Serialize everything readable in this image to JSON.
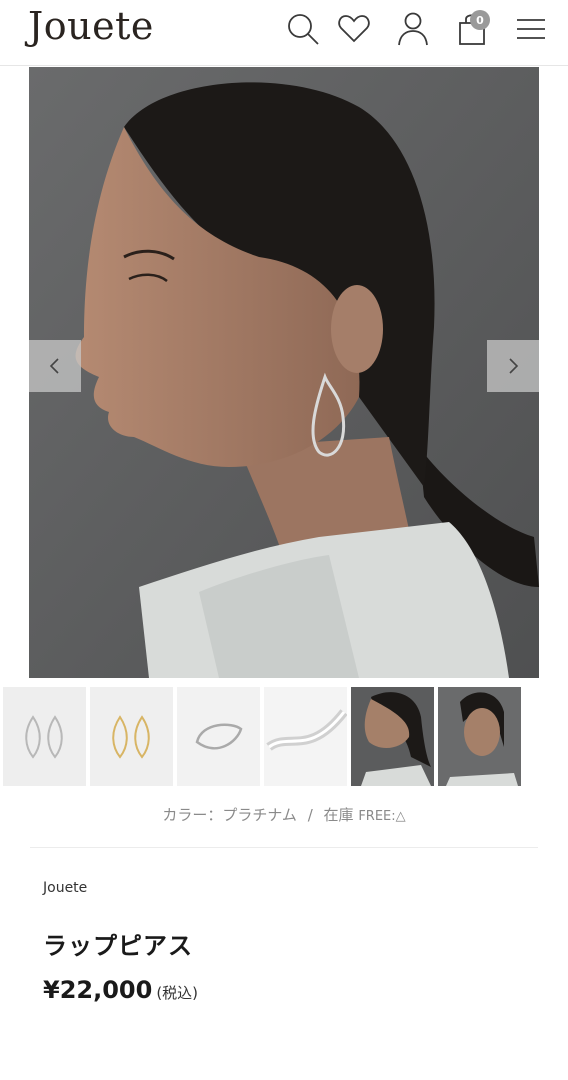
{
  "header": {
    "logo": "Jouete",
    "cart_count": "0"
  },
  "icons": [
    "search-icon",
    "heart-icon",
    "user-icon",
    "shopping-bag-icon",
    "hamburger-menu-icon",
    "chevron-left-icon",
    "chevron-right-icon"
  ],
  "product": {
    "color_label": "カラー：プラチナム",
    "separator": "/",
    "stock_label": "在庫",
    "stock_value": "FREE:△",
    "brand": "Jouete",
    "name": "ラップピアス",
    "price": "¥22,000",
    "tax_note": "(税込)"
  },
  "gallery": {
    "thumbnail_count": 6,
    "active_index": 0
  },
  "colors": {
    "background": "#ffffff",
    "text": "#1a1a1a",
    "muted": "#8a8a8a",
    "badge": "#9a9a9a"
  }
}
